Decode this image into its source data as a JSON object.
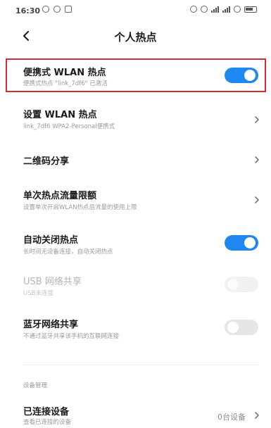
{
  "status_bar": {
    "time": "16:30"
  },
  "header": {
    "title": "个人热点"
  },
  "rows": {
    "portable_wlan": {
      "title": "便携式 WLAN 热点",
      "subtitle": "便携式热点 \"link_7df6\" 已激活",
      "toggle_state": "on"
    },
    "setup_wlan": {
      "title": "设置 WLAN 热点",
      "subtitle": "link_7df6 WPA2-Personal便携式"
    },
    "qr_share": {
      "title": "二维码分享"
    },
    "data_limit": {
      "title": "单次热点流量限额",
      "subtitle": "设置单次开启WLAN热点后流量的使用上限"
    },
    "auto_off": {
      "title": "自动关闭热点",
      "subtitle": "长时间无设备连接，自动关闭热点",
      "toggle_state": "on"
    },
    "usb_tether": {
      "title": "USB 网络共享",
      "subtitle": "USB未连接",
      "toggle_state": "disabled"
    },
    "bt_tether": {
      "title": "蓝牙网络共享",
      "subtitle": "不通过蓝牙共享该手机的互联网连接",
      "toggle_state": "off"
    }
  },
  "device_section": {
    "label": "设备管理",
    "connected": {
      "title": "已连接设备",
      "subtitle": "查看已连接的设备",
      "count": "0台设备"
    }
  },
  "colors": {
    "accent": "#1f87f0",
    "highlight": "#d82a35"
  }
}
